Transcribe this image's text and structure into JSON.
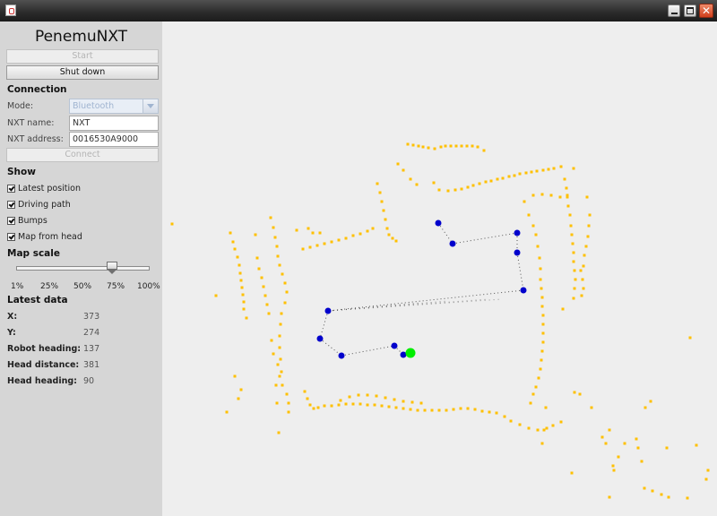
{
  "window": {
    "close_glyph": "✕"
  },
  "app_title": "PenemuNXT",
  "buttons": {
    "start": "Start",
    "shutdown": "Shut down",
    "connect": "Connect"
  },
  "connection": {
    "heading": "Connection",
    "mode_label": "Mode:",
    "mode_value": "Bluetooth",
    "name_label": "NXT name:",
    "name_value": "NXT",
    "address_label": "NXT address:",
    "address_value": "0016530A9000"
  },
  "show": {
    "heading": "Show",
    "options": [
      {
        "label": "Latest position",
        "checked": true
      },
      {
        "label": "Driving path",
        "checked": true
      },
      {
        "label": "Bumps",
        "checked": true
      },
      {
        "label": "Map from head",
        "checked": true
      }
    ]
  },
  "map_scale": {
    "heading": "Map scale",
    "value_percent": 72,
    "ticks": [
      "1%",
      "25%",
      "50%",
      "75%",
      "100%"
    ]
  },
  "latest_data": {
    "heading": "Latest data",
    "rows": [
      {
        "label": "X:",
        "value": "373"
      },
      {
        "label": "Y:",
        "value": "274"
      },
      {
        "label": "Robot heading:",
        "value": "137"
      },
      {
        "label": "Head distance:",
        "value": "381"
      },
      {
        "label": "Head heading:",
        "value": "90"
      }
    ]
  },
  "colors": {
    "map_point": "#ffc000",
    "path_point": "#0000cc",
    "path_line": "#555555",
    "robot": "#00ee00",
    "map_background": "#eeeeee",
    "sidebar_background": "#d6d6d6"
  },
  "map": {
    "head_points": [
      [
        455,
        161
      ],
      [
        461,
        162
      ],
      [
        467,
        163
      ],
      [
        472,
        164
      ],
      [
        478,
        165
      ],
      [
        485,
        166
      ],
      [
        492,
        164
      ],
      [
        497,
        163
      ],
      [
        503,
        163
      ],
      [
        509,
        163
      ],
      [
        515,
        163
      ],
      [
        521,
        163
      ],
      [
        527,
        163
      ],
      [
        533,
        164
      ],
      [
        540,
        168
      ],
      [
        444,
        183
      ],
      [
        450,
        190
      ],
      [
        458,
        200
      ],
      [
        465,
        206
      ],
      [
        484,
        204
      ],
      [
        490,
        212
      ],
      [
        500,
        213
      ],
      [
        508,
        212
      ],
      [
        515,
        211
      ],
      [
        522,
        209
      ],
      [
        528,
        207
      ],
      [
        535,
        205
      ],
      [
        542,
        203
      ],
      [
        548,
        202
      ],
      [
        555,
        200
      ],
      [
        561,
        199
      ],
      [
        568,
        197
      ],
      [
        574,
        196
      ],
      [
        580,
        194
      ],
      [
        587,
        193
      ],
      [
        593,
        192
      ],
      [
        599,
        191
      ],
      [
        606,
        190
      ],
      [
        612,
        189
      ],
      [
        618,
        188
      ],
      [
        626,
        186
      ],
      [
        640,
        188
      ],
      [
        421,
        205
      ],
      [
        424,
        215
      ],
      [
        426,
        225
      ],
      [
        428,
        235
      ],
      [
        430,
        245
      ],
      [
        432,
        255
      ],
      [
        434,
        262
      ],
      [
        438,
        266
      ],
      [
        442,
        269
      ],
      [
        416,
        255
      ],
      [
        410,
        258
      ],
      [
        402,
        261
      ],
      [
        394,
        263
      ],
      [
        386,
        266
      ],
      [
        378,
        268
      ],
      [
        370,
        270
      ],
      [
        362,
        272
      ],
      [
        354,
        274
      ],
      [
        346,
        276
      ],
      [
        338,
        278
      ],
      [
        331,
        257
      ],
      [
        344,
        255
      ],
      [
        349,
        260
      ],
      [
        357,
        260
      ],
      [
        302,
        243
      ],
      [
        305,
        254
      ],
      [
        307,
        265
      ],
      [
        309,
        275
      ],
      [
        310,
        286
      ],
      [
        312,
        296
      ],
      [
        315,
        306
      ],
      [
        318,
        316
      ],
      [
        320,
        326
      ],
      [
        318,
        338
      ],
      [
        314,
        350
      ],
      [
        313,
        362
      ],
      [
        312,
        375
      ],
      [
        312,
        388
      ],
      [
        313,
        401
      ],
      [
        314,
        415
      ],
      [
        315,
        430
      ],
      [
        320,
        440
      ],
      [
        322,
        450
      ],
      [
        322,
        460
      ],
      [
        257,
        260
      ],
      [
        260,
        270
      ],
      [
        262,
        278
      ],
      [
        265,
        287
      ],
      [
        267,
        296
      ],
      [
        268,
        305
      ],
      [
        269,
        313
      ],
      [
        270,
        321
      ],
      [
        271,
        329
      ],
      [
        272,
        337
      ],
      [
        272,
        345
      ],
      [
        275,
        355
      ],
      [
        192,
        250
      ],
      [
        241,
        330
      ],
      [
        253,
        460
      ],
      [
        262,
        420
      ],
      [
        266,
        445
      ],
      [
        269,
        435
      ],
      [
        285,
        262
      ],
      [
        287,
        288
      ],
      [
        289,
        300
      ],
      [
        292,
        310
      ],
      [
        294,
        320
      ],
      [
        296,
        330
      ],
      [
        298,
        340
      ],
      [
        300,
        350
      ],
      [
        303,
        380
      ],
      [
        305,
        395
      ],
      [
        310,
        407
      ],
      [
        312,
        420
      ],
      [
        308,
        430
      ],
      [
        309,
        450
      ],
      [
        311,
        483
      ],
      [
        340,
        437
      ],
      [
        343,
        445
      ],
      [
        346,
        452
      ],
      [
        350,
        456
      ],
      [
        355,
        455
      ],
      [
        362,
        453
      ],
      [
        370,
        453
      ],
      [
        378,
        452
      ],
      [
        386,
        451
      ],
      [
        394,
        451
      ],
      [
        402,
        451
      ],
      [
        410,
        452
      ],
      [
        418,
        452
      ],
      [
        426,
        453
      ],
      [
        434,
        454
      ],
      [
        442,
        455
      ],
      [
        450,
        456
      ],
      [
        458,
        457
      ],
      [
        466,
        458
      ],
      [
        474,
        458
      ],
      [
        482,
        458
      ],
      [
        490,
        458
      ],
      [
        498,
        458
      ],
      [
        506,
        457
      ],
      [
        514,
        456
      ],
      [
        522,
        456
      ],
      [
        530,
        457
      ],
      [
        538,
        459
      ],
      [
        546,
        460
      ],
      [
        554,
        461
      ],
      [
        380,
        447
      ],
      [
        390,
        443
      ],
      [
        400,
        441
      ],
      [
        410,
        441
      ],
      [
        420,
        442
      ],
      [
        430,
        444
      ],
      [
        440,
        446
      ],
      [
        450,
        448
      ],
      [
        460,
        449
      ],
      [
        470,
        450
      ],
      [
        585,
        225
      ],
      [
        595,
        218
      ],
      [
        605,
        217
      ],
      [
        615,
        218
      ],
      [
        625,
        220
      ],
      [
        633,
        218
      ],
      [
        590,
        240
      ],
      [
        595,
        252
      ],
      [
        598,
        262
      ],
      [
        600,
        275
      ],
      [
        602,
        288
      ],
      [
        603,
        300
      ],
      [
        603,
        312
      ],
      [
        604,
        322
      ],
      [
        605,
        332
      ],
      [
        605,
        342
      ],
      [
        606,
        352
      ],
      [
        606,
        362
      ],
      [
        606,
        372
      ],
      [
        606,
        382
      ],
      [
        605,
        392
      ],
      [
        604,
        402
      ],
      [
        603,
        412
      ],
      [
        601,
        422
      ],
      [
        598,
        432
      ],
      [
        595,
        440
      ],
      [
        592,
        450
      ],
      [
        630,
        200
      ],
      [
        632,
        210
      ],
      [
        633,
        220
      ],
      [
        634,
        230
      ],
      [
        636,
        240
      ],
      [
        637,
        252
      ],
      [
        638,
        262
      ],
      [
        639,
        272
      ],
      [
        640,
        282
      ],
      [
        640,
        292
      ],
      [
        641,
        302
      ],
      [
        642,
        312
      ],
      [
        641,
        322
      ],
      [
        640,
        333
      ],
      [
        628,
        345
      ],
      [
        648,
        302
      ],
      [
        650,
        312
      ],
      [
        651,
        322
      ],
      [
        649,
        330
      ],
      [
        651,
        297
      ],
      [
        652,
        285
      ],
      [
        654,
        275
      ],
      [
        656,
        264
      ],
      [
        657,
        252
      ],
      [
        658,
        240
      ],
      [
        655,
        220
      ],
      [
        563,
        465
      ],
      [
        570,
        470
      ],
      [
        580,
        474
      ],
      [
        590,
        478
      ],
      [
        600,
        480
      ],
      [
        610,
        478
      ],
      [
        617,
        475
      ],
      [
        626,
        471
      ],
      [
        609,
        455
      ],
      [
        607,
        480
      ],
      [
        605,
        495
      ],
      [
        641,
        438
      ],
      [
        647,
        440
      ],
      [
        660,
        455
      ],
      [
        672,
        488
      ],
      [
        676,
        495
      ],
      [
        680,
        480
      ],
      [
        685,
        525
      ],
      [
        684,
        520
      ],
      [
        690,
        510
      ],
      [
        697,
        495
      ],
      [
        710,
        490
      ],
      [
        712,
        500
      ],
      [
        716,
        515
      ],
      [
        719,
        545
      ],
      [
        728,
        548
      ],
      [
        738,
        552
      ],
      [
        746,
        555
      ],
      [
        720,
        455
      ],
      [
        726,
        448
      ],
      [
        744,
        500
      ],
      [
        767,
        556
      ],
      [
        770,
        377
      ],
      [
        777,
        497
      ],
      [
        788,
        535
      ],
      [
        790,
        525
      ],
      [
        638,
        528
      ],
      [
        680,
        555
      ]
    ],
    "path_points": [
      [
        489,
        249
      ],
      [
        505,
        272
      ],
      [
        577,
        260
      ],
      [
        577,
        282
      ],
      [
        584,
        324
      ],
      [
        366,
        347
      ],
      [
        357,
        378
      ],
      [
        381,
        397
      ],
      [
        440,
        386
      ],
      [
        450,
        396
      ]
    ],
    "robot": [
      458,
      394
    ],
    "scan_ends": [
      [
        560,
        334
      ],
      [
        545,
        334
      ],
      [
        500,
        336
      ],
      [
        470,
        338
      ]
    ]
  }
}
